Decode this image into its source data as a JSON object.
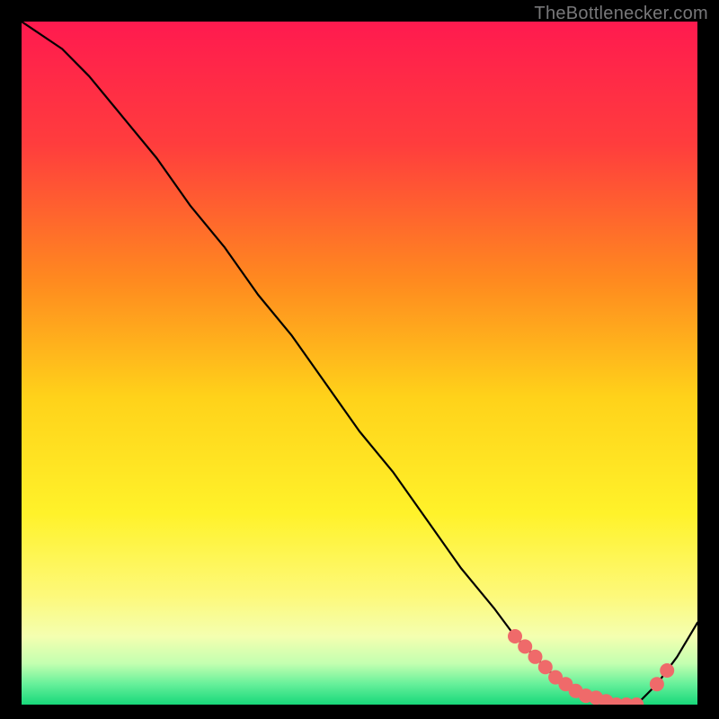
{
  "attribution": "TheBottlenecker.com",
  "chart_data": {
    "type": "line",
    "title": "",
    "xlabel": "",
    "ylabel": "",
    "xlim": [
      0,
      100
    ],
    "ylim": [
      0,
      100
    ],
    "series": [
      {
        "name": "curve",
        "x": [
          0,
          6,
          10,
          15,
          20,
          25,
          30,
          35,
          40,
          45,
          50,
          55,
          60,
          65,
          70,
          73,
          76,
          79,
          82,
          85,
          88,
          91,
          94,
          97,
          100
        ],
        "y": [
          100,
          96,
          92,
          86,
          80,
          73,
          67,
          60,
          54,
          47,
          40,
          34,
          27,
          20,
          14,
          10,
          7,
          4,
          2,
          1,
          0,
          0,
          3,
          7,
          12
        ]
      }
    ],
    "markers": {
      "name": "dots",
      "x": [
        73,
        74.5,
        76,
        77.5,
        79,
        80.5,
        82,
        83.5,
        85,
        86.5,
        88,
        89.5,
        91,
        94,
        95.5
      ],
      "y": [
        10,
        8.5,
        7,
        5.5,
        4,
        3,
        2,
        1.3,
        1,
        0.5,
        0,
        0,
        0,
        3,
        5
      ]
    },
    "gradient_stops": [
      {
        "offset": 0.0,
        "color": "#ff1a4f"
      },
      {
        "offset": 0.18,
        "color": "#ff3d3d"
      },
      {
        "offset": 0.38,
        "color": "#ff8a1f"
      },
      {
        "offset": 0.55,
        "color": "#ffd21a"
      },
      {
        "offset": 0.72,
        "color": "#fff22a"
      },
      {
        "offset": 0.84,
        "color": "#fdf97a"
      },
      {
        "offset": 0.9,
        "color": "#f4ffb0"
      },
      {
        "offset": 0.94,
        "color": "#c3ffb0"
      },
      {
        "offset": 0.97,
        "color": "#66f09a"
      },
      {
        "offset": 1.0,
        "color": "#18d87a"
      }
    ]
  }
}
